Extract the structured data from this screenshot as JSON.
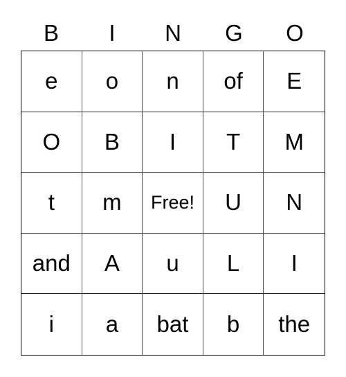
{
  "header": [
    "B",
    "I",
    "N",
    "G",
    "O"
  ],
  "cells": [
    [
      "e",
      "o",
      "n",
      "of",
      "E"
    ],
    [
      "O",
      "B",
      "I",
      "T",
      "M"
    ],
    [
      "t",
      "m",
      "Free!",
      "U",
      "N"
    ],
    [
      "and",
      "A",
      "u",
      "L",
      "I"
    ],
    [
      "i",
      "a",
      "bat",
      "b",
      "the"
    ]
  ]
}
